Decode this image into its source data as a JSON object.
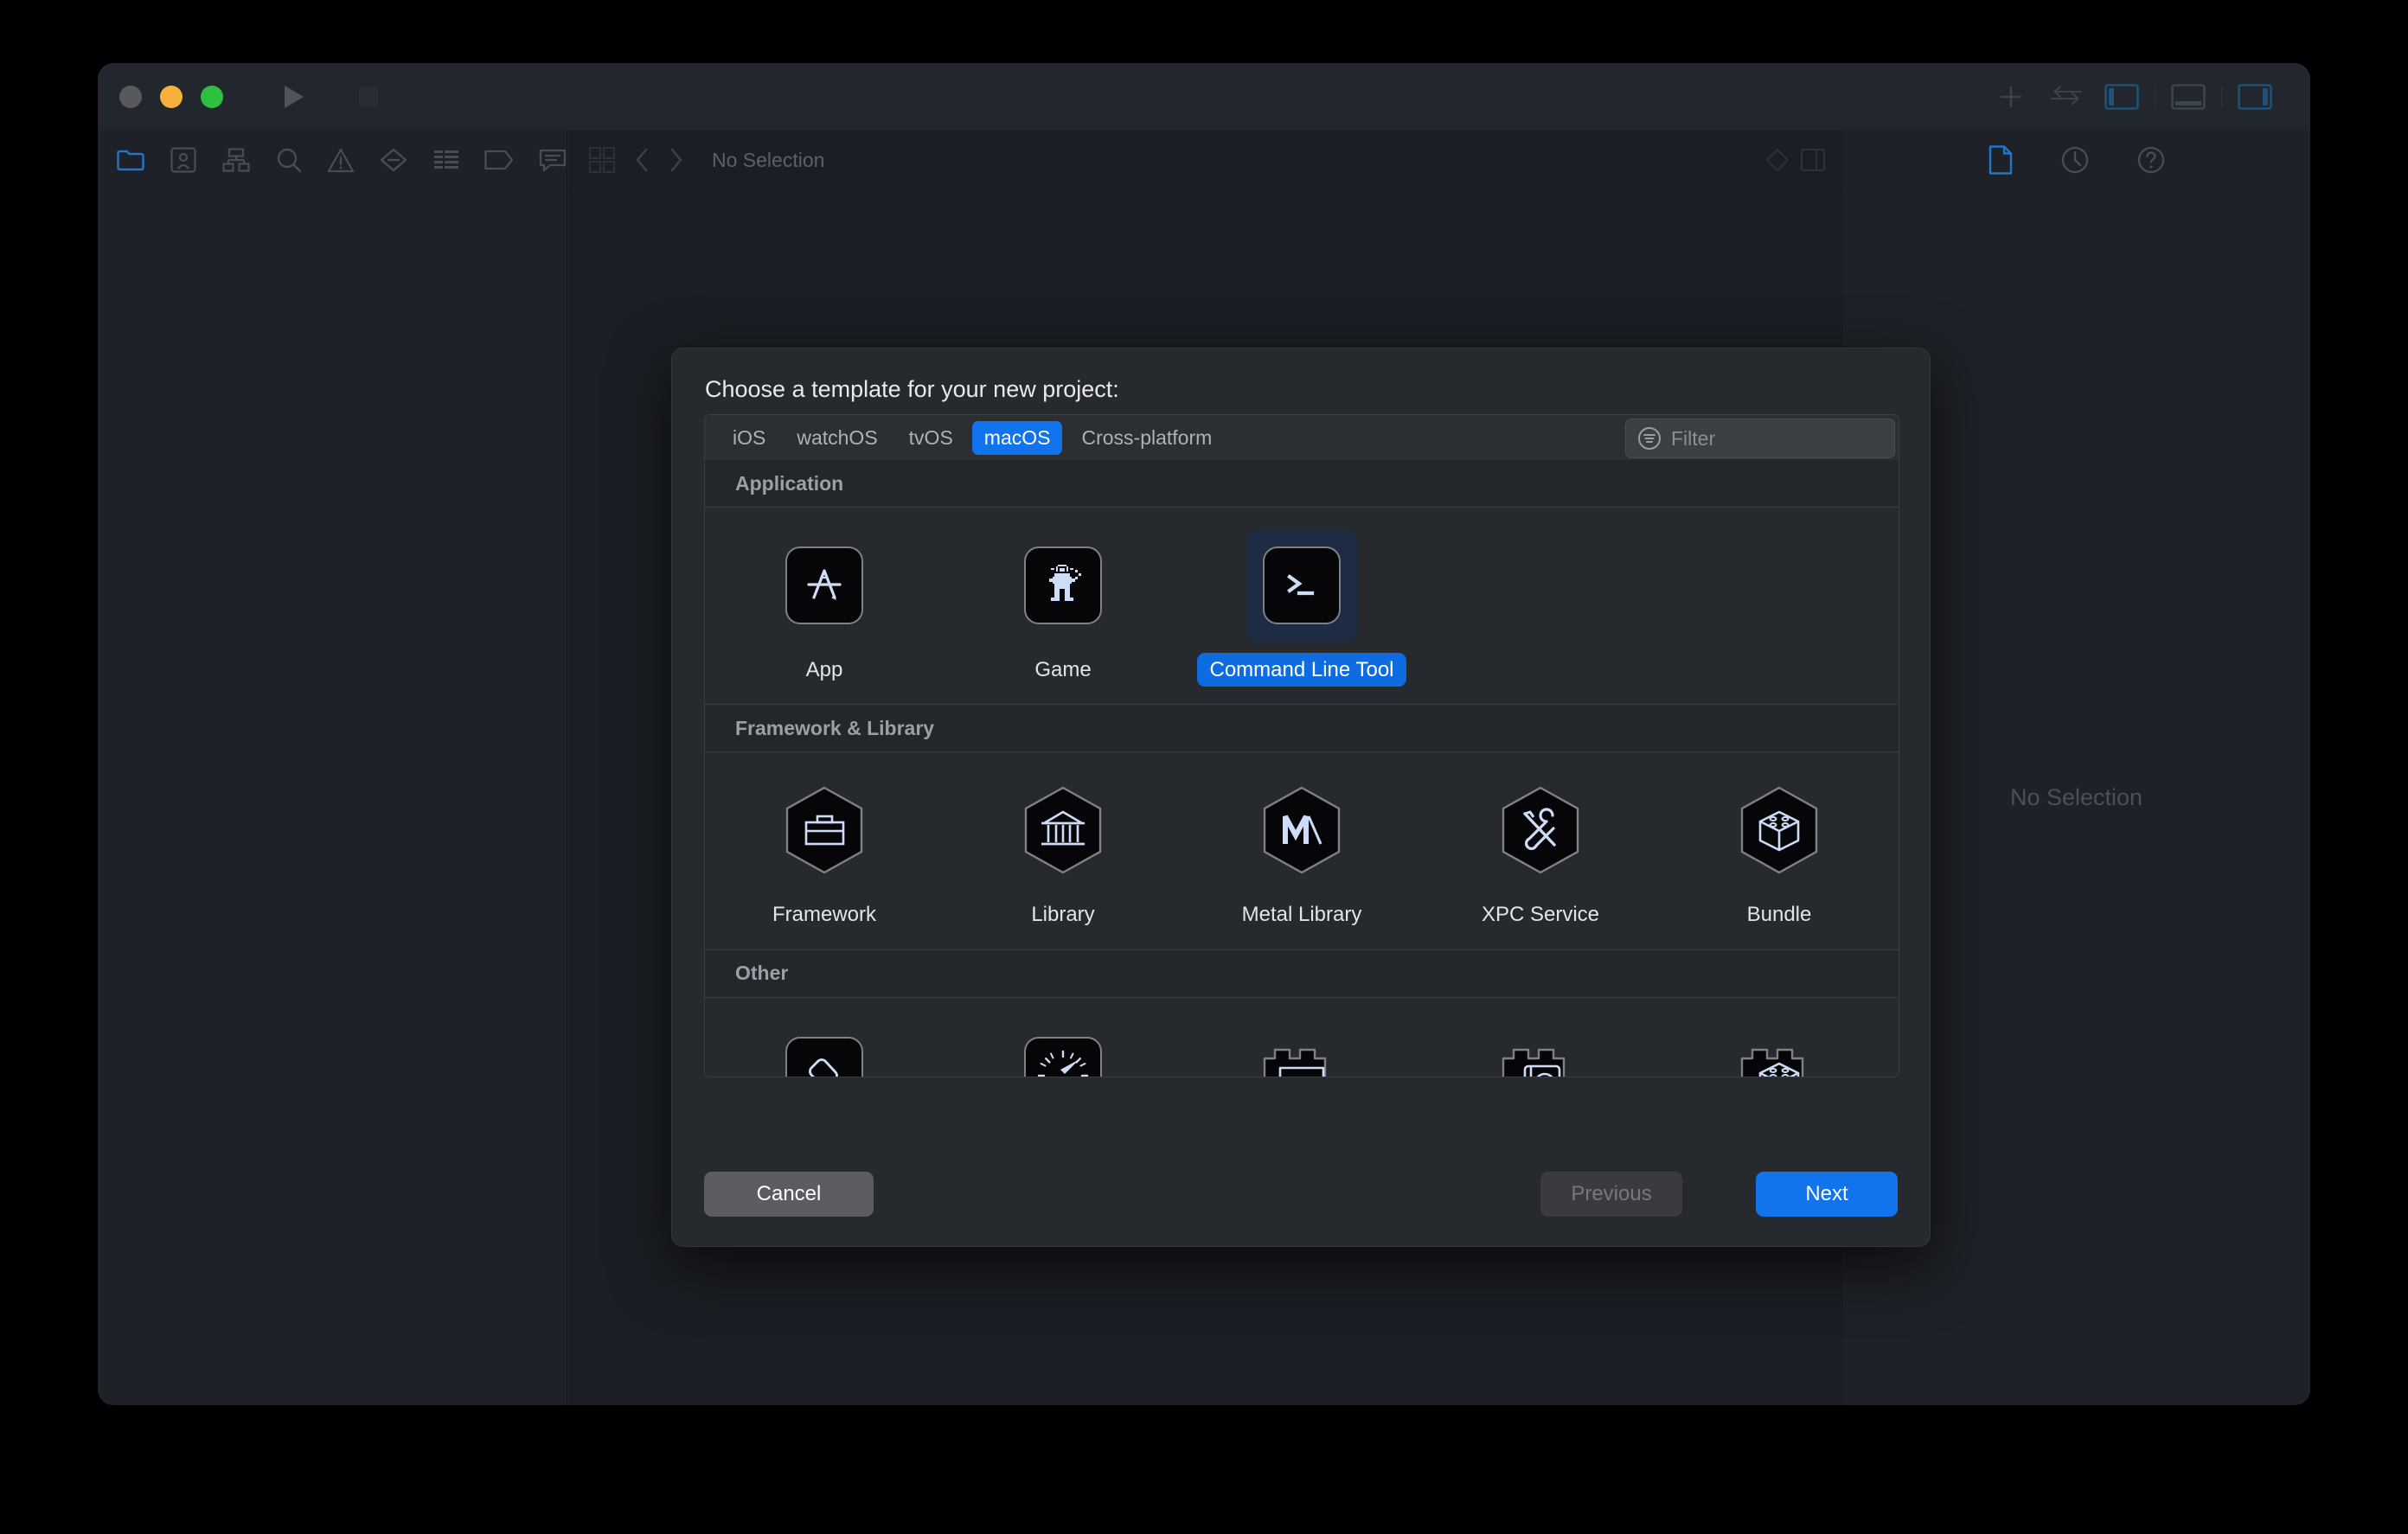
{
  "window": {
    "traffic_lights": [
      "close",
      "minimize",
      "zoom"
    ],
    "run_button": "run",
    "stop_button": "stop",
    "toolbar_right": [
      "add-icon",
      "swap-arrows-icon",
      "toggle-navigator-icon",
      "toggle-debug-area-icon",
      "toggle-inspector-icon"
    ],
    "navigator_icons": [
      "project-navigator-icon",
      "source-control-navigator-icon",
      "symbol-navigator-icon",
      "find-navigator-icon",
      "issue-navigator-icon",
      "test-navigator-icon",
      "debug-navigator-icon",
      "breakpoint-navigator-icon",
      "report-navigator-icon"
    ],
    "jumpbar": {
      "related_items_icon": "related-items-icon",
      "back_icon": "chevron-left-icon",
      "forward_icon": "chevron-right-icon",
      "path": "No Selection"
    },
    "inspector_icons": [
      "file-inspector-icon",
      "history-inspector-icon",
      "quick-help-icon"
    ],
    "inspector_empty": "No Selection"
  },
  "dialog": {
    "title": "Choose a template for your new project:",
    "platforms": [
      {
        "label": "iOS",
        "selected": false
      },
      {
        "label": "watchOS",
        "selected": false
      },
      {
        "label": "tvOS",
        "selected": false
      },
      {
        "label": "macOS",
        "selected": true
      },
      {
        "label": "Cross-platform",
        "selected": false
      }
    ],
    "filter": {
      "placeholder": "Filter",
      "value": "",
      "icon": "filter-icon"
    },
    "sections": [
      {
        "header": "Application",
        "items": [
          {
            "label": "App",
            "icon": "app-store-icon",
            "shape": "rounded",
            "selected": false
          },
          {
            "label": "Game",
            "icon": "game-sprite-icon",
            "shape": "rounded",
            "selected": false
          },
          {
            "label": "Command Line Tool",
            "icon": "terminal-prompt-icon",
            "shape": "rounded",
            "selected": true
          }
        ]
      },
      {
        "header": "Framework & Library",
        "items": [
          {
            "label": "Framework",
            "icon": "briefcase-icon",
            "shape": "hexagon",
            "selected": false
          },
          {
            "label": "Library",
            "icon": "classical-building-icon",
            "shape": "hexagon",
            "selected": false
          },
          {
            "label": "Metal Library",
            "icon": "metal-m-icon",
            "shape": "hexagon",
            "selected": false
          },
          {
            "label": "XPC Service",
            "icon": "wrench-screwdriver-icon",
            "shape": "hexagon",
            "selected": false
          },
          {
            "label": "Bundle",
            "icon": "brick-cube-icon",
            "shape": "hexagon",
            "selected": false
          }
        ]
      },
      {
        "header": "Other",
        "items": [
          {
            "label": "",
            "icon": "applescript-scroll-icon",
            "shape": "rounded",
            "selected": false
          },
          {
            "label": "",
            "icon": "safari-compass-icon",
            "shape": "rounded",
            "selected": false
          },
          {
            "label": "",
            "icon": "plugin-bowtie-icon",
            "shape": "plugin",
            "selected": false
          },
          {
            "label": "",
            "icon": "plugin-contacts-icon",
            "shape": "plugin",
            "selected": false
          },
          {
            "label": "",
            "icon": "plugin-cube-icon",
            "shape": "plugin",
            "selected": false
          }
        ]
      }
    ],
    "buttons": {
      "cancel": "Cancel",
      "previous": "Previous",
      "next": "Next"
    }
  },
  "colors": {
    "accent_blue": "#1274ec",
    "selected_label_blue": "#0e6ce0",
    "selection_tile": "#1d2b43",
    "sheet_bg": "#26292e",
    "window_bg": "#1e2127",
    "editor_bg": "#1b1e24"
  }
}
